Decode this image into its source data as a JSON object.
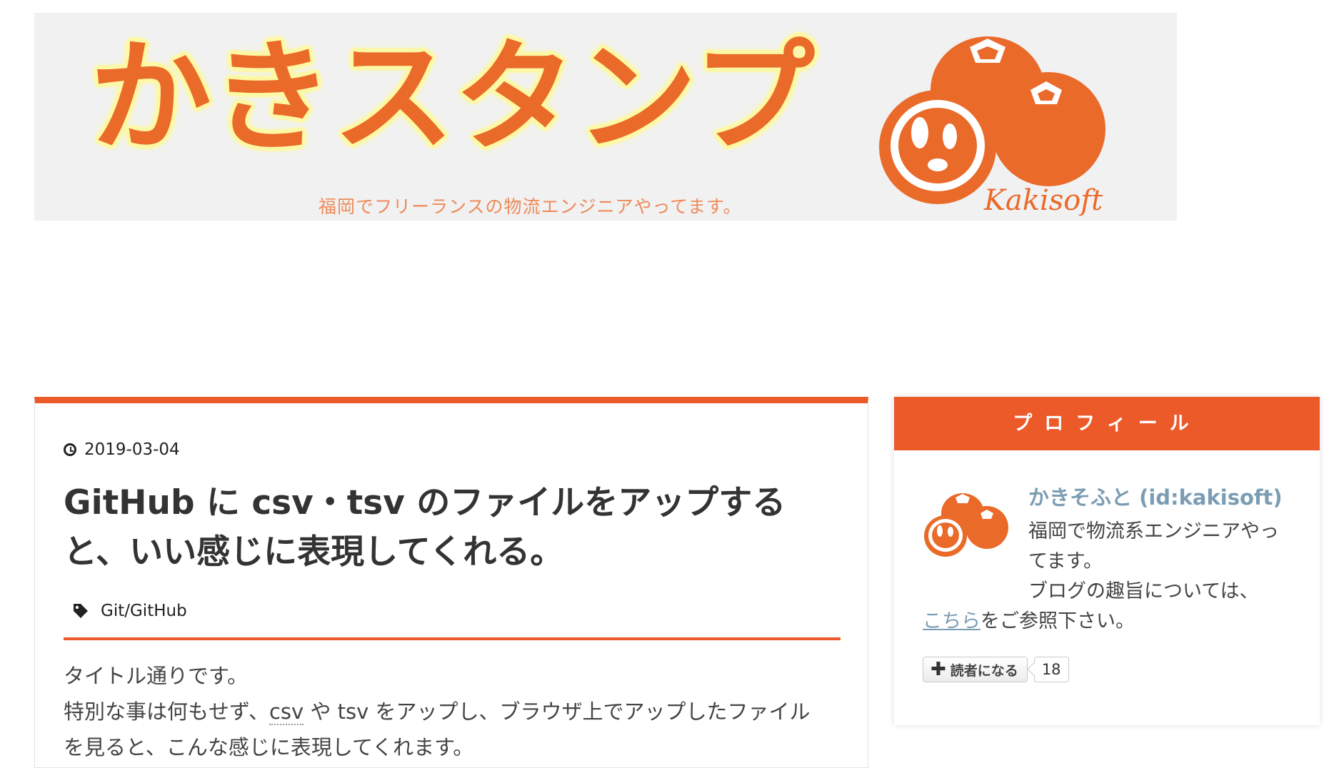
{
  "banner": {
    "title": "かきスタンプ",
    "tagline": "福岡でフリーランスの物流エンジニアやってます。",
    "logo_text": "Kakisoft"
  },
  "article": {
    "date": "2019-03-04",
    "title": "GitHub に csv・tsv のファイルをアップすると、いい感じに表現してくれる。",
    "tag": "Git/GitHub",
    "body": {
      "line1": "タイトル通りです。",
      "line2_pre": "特別な事は何もせず、",
      "line2_csv": "csv",
      "line2_post": " や tsv をアップし、ブラウザ上でアップしたファイル",
      "line3": "を見ると、こんな感じに表現してくれます。"
    }
  },
  "profile": {
    "header": "プロフィール",
    "name": "かきそふと (id:kakisoft)",
    "desc1": "福岡で物流系エンジニアやってます。",
    "desc2_pre": "ブログの趣旨については、",
    "link": "こちら",
    "desc2_post": "をご参照下さい。",
    "subscribe_label": "読者になる",
    "subscriber_count": "18"
  },
  "colors": {
    "accent": "#ec5a2a",
    "link": "#7b9db4",
    "persimmon": "#ea6a2a",
    "banner_glow": "#fdf8a6"
  },
  "icons": [
    "clock-icon",
    "tag-icon",
    "plus-icon",
    "persimmon-logo"
  ]
}
